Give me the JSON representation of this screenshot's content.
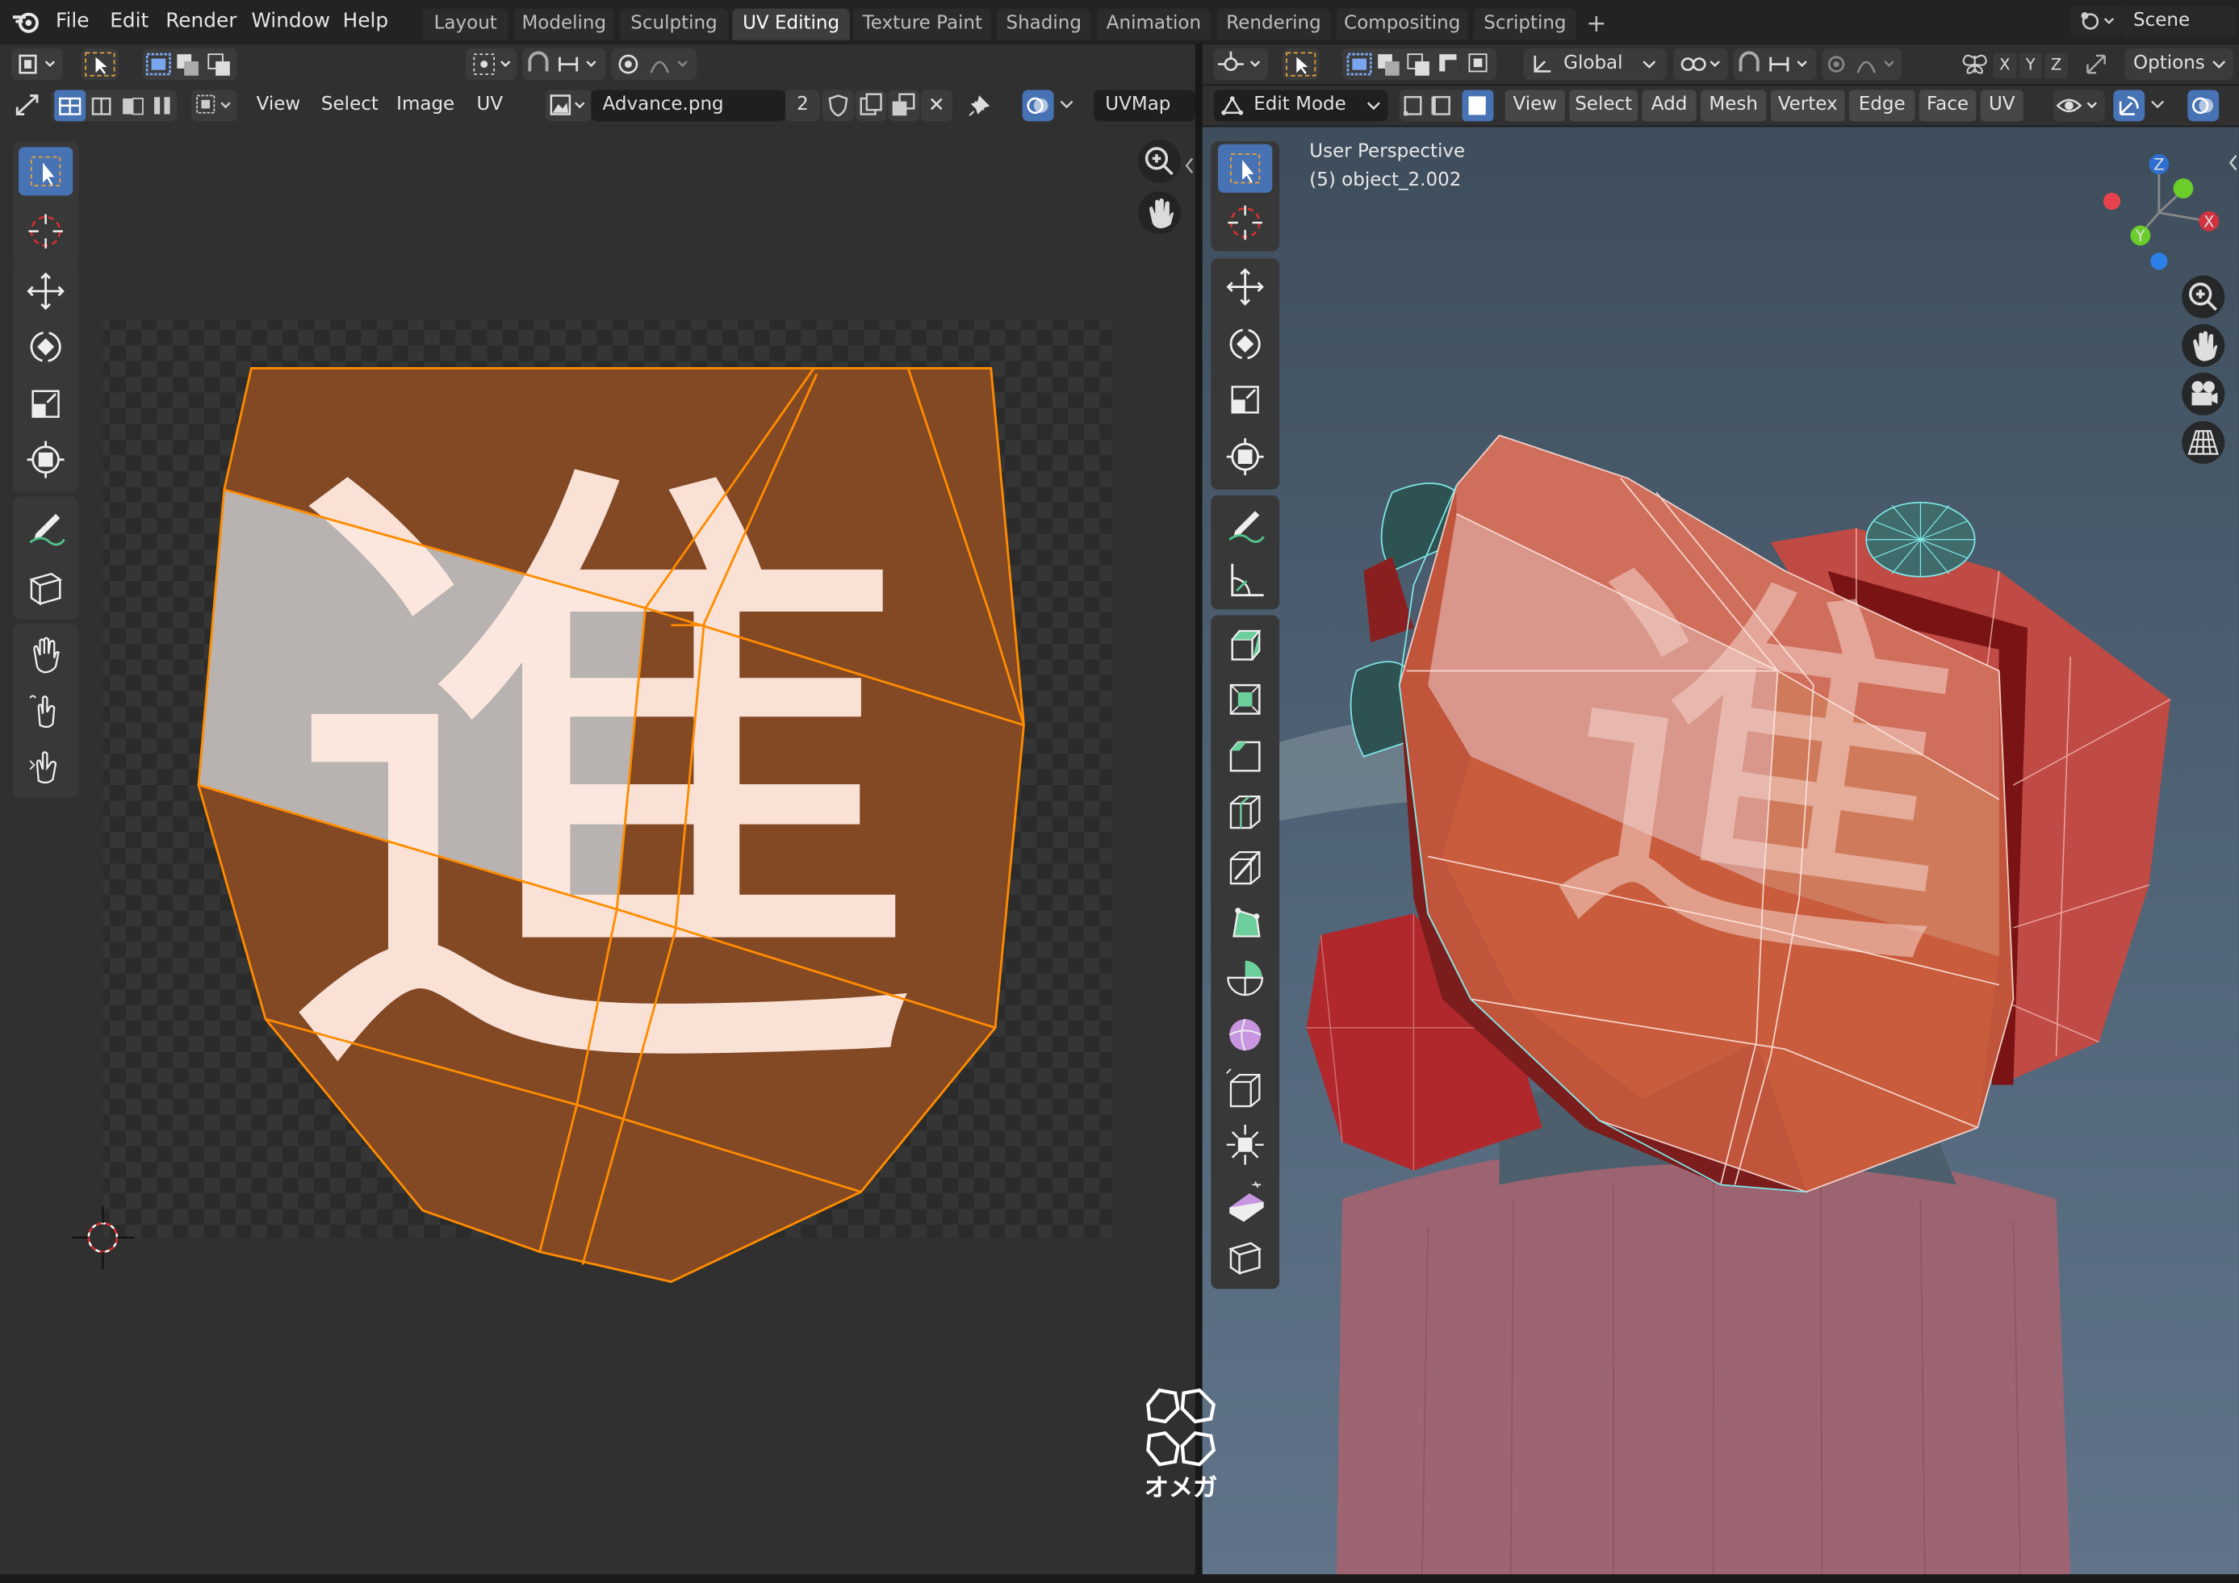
{
  "topbar": {
    "menu": [
      "File",
      "Edit",
      "Render",
      "Window",
      "Help"
    ],
    "workspaces": [
      "Layout",
      "Modeling",
      "Sculpting",
      "UV Editing",
      "Texture Paint",
      "Shading",
      "Animation",
      "Rendering",
      "Compositing",
      "Scripting"
    ],
    "active_workspace": "UV Editing",
    "add_tab": "+",
    "scene_label": "Scene"
  },
  "uv_editor": {
    "header_menu": [
      "View",
      "Select",
      "Image",
      "UV"
    ],
    "image_name": "Advance.png",
    "image_users": "2",
    "uv_map": "UVMap",
    "close_glyph": "✕"
  },
  "viewport": {
    "orientation": "Global",
    "options_label": "Options",
    "axis_buttons": [
      "X",
      "Y",
      "Z"
    ],
    "mode": "Edit Mode",
    "header_menu": [
      "View",
      "Select",
      "Add",
      "Mesh",
      "Vertex",
      "Edge",
      "Face",
      "UV"
    ],
    "info_line1": "User Perspective",
    "info_line2": "(5) object_2.002",
    "gizmo_axes": {
      "z": "Z",
      "y": "Y",
      "x": "X"
    }
  },
  "texture": {
    "kanji": "進"
  },
  "watermark": {
    "text": "オメガ"
  },
  "colors": {
    "accent": "#4772b3",
    "uv_orange": "#ff8c00",
    "face_fill": "#8a4a24",
    "mesh_red": "#c45348",
    "wire_cyan": "#7fe6e6"
  }
}
